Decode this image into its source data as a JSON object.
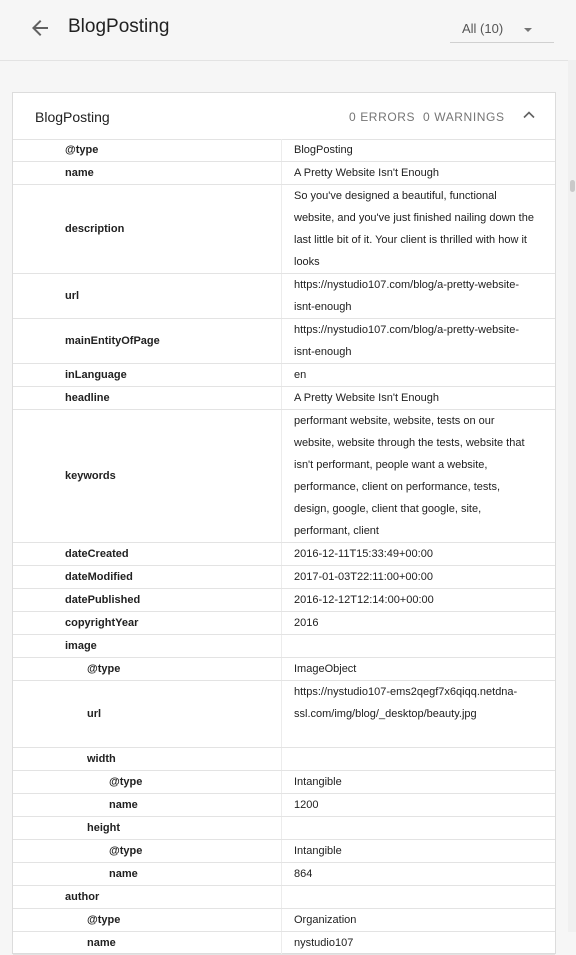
{
  "header": {
    "back_icon": "arrow-back-icon",
    "title": "BlogPosting",
    "filter": "All (10)"
  },
  "card": {
    "title": "BlogPosting",
    "errors": "0 ERRORS",
    "warnings": "0 WARNINGS"
  },
  "rows": [
    {
      "key": "@type",
      "value": "BlogPosting",
      "level": 0,
      "lines": 1
    },
    {
      "key": "name",
      "value": "A Pretty Website Isn't Enough",
      "level": 0,
      "lines": 1
    },
    {
      "key": "description",
      "value": "So you've designed a beautiful, functional website, and you've just finished nailing down the last little bit of it. Your client is thrilled with how it looks",
      "level": 0,
      "lines": 4
    },
    {
      "key": "url",
      "value": "https://nystudio107.com/blog/a-pretty-website-isnt-enough",
      "level": 0,
      "lines": 2
    },
    {
      "key": "mainEntityOfPage",
      "value": "https://nystudio107.com/blog/a-pretty-website-isnt-enough",
      "level": 0,
      "lines": 2
    },
    {
      "key": "inLanguage",
      "value": "en",
      "level": 0,
      "lines": 1
    },
    {
      "key": "headline",
      "value": "A Pretty Website Isn't Enough",
      "level": 0,
      "lines": 1
    },
    {
      "key": "keywords",
      "value": "performant website, website, tests on our website, website through the tests, website that isn't performant, people want a website, performance, client on performance, tests, design, google, client that google, site, performant, client",
      "level": 0,
      "lines": 6
    },
    {
      "key": "dateCreated",
      "value": "2016-12-11T15:33:49+00:00",
      "level": 0,
      "lines": 1
    },
    {
      "key": "dateModified",
      "value": "2017-01-03T22:11:00+00:00",
      "level": 0,
      "lines": 1
    },
    {
      "key": "datePublished",
      "value": "2016-12-12T12:14:00+00:00",
      "level": 0,
      "lines": 1
    },
    {
      "key": "copyrightYear",
      "value": "2016",
      "level": 0,
      "lines": 1
    },
    {
      "key": "image",
      "value": "",
      "level": 0,
      "lines": 1
    },
    {
      "key": "@type",
      "value": "ImageObject",
      "level": 1,
      "lines": 1
    },
    {
      "key": "url",
      "value": "https://nystudio107-ems2qegf7x6qiqq.netdna-ssl.com/img/blog/_desktop/beauty.jpg",
      "level": 1,
      "lines": 3
    },
    {
      "key": "width",
      "value": "",
      "level": 1,
      "lines": 1
    },
    {
      "key": "@type",
      "value": "Intangible",
      "level": 2,
      "lines": 1
    },
    {
      "key": "name",
      "value": "1200",
      "level": 2,
      "lines": 1
    },
    {
      "key": "height",
      "value": "",
      "level": 1,
      "lines": 1
    },
    {
      "key": "@type",
      "value": "Intangible",
      "level": 2,
      "lines": 1
    },
    {
      "key": "name",
      "value": "864",
      "level": 2,
      "lines": 1
    },
    {
      "key": "author",
      "value": "",
      "level": 0,
      "lines": 1
    },
    {
      "key": "@type",
      "value": "Organization",
      "level": 1,
      "lines": 1
    },
    {
      "key": "name",
      "value": "nystudio107",
      "level": 1,
      "lines": 1
    }
  ]
}
